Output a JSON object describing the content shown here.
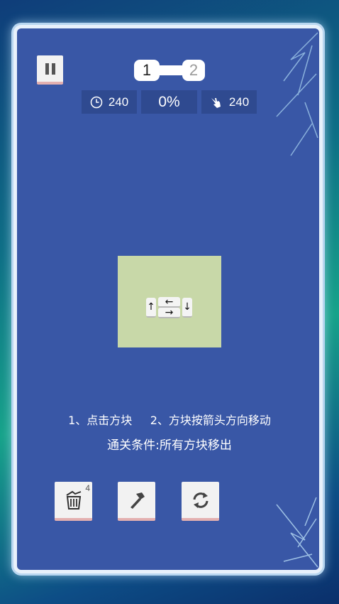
{
  "hud": {
    "level_current": "1",
    "level_next": "2",
    "time": "240",
    "progress": "0%",
    "moves": "240"
  },
  "board": {
    "tiles": [
      {
        "glyph": "↑"
      },
      {
        "glyph": "←"
      },
      {
        "glyph": "→"
      },
      {
        "glyph": "↓"
      }
    ]
  },
  "instructions": {
    "line1": "1、点击方块     2、方块按箭头方向移动",
    "line2": "通关条件:所有方块移出"
  },
  "tools": {
    "remove_count": "4"
  },
  "icons": {
    "pause": "pause-icon",
    "clock": "clock-icon",
    "hand": "hand-pointer-icon",
    "trash": "trash-bin-icon",
    "hammer": "hammer-icon",
    "shuffle": "refresh-icon"
  },
  "colors": {
    "panel": "#3957a6",
    "board": "#c8d8a8",
    "stat_bg": "#2f4a90"
  }
}
